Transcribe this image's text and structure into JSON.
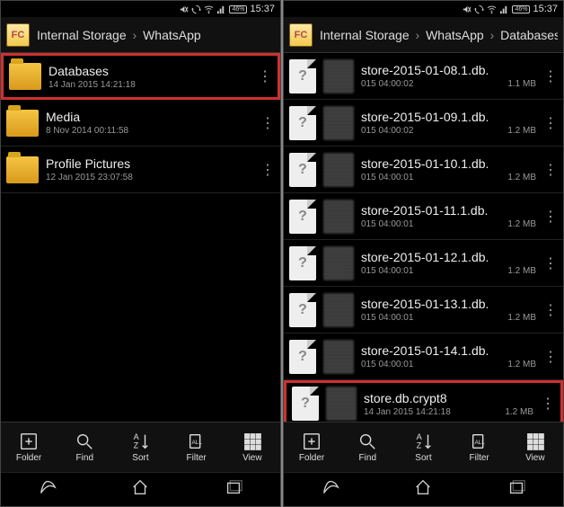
{
  "left": {
    "status": {
      "battery": "46%",
      "time": "15:37"
    },
    "breadcrumb": [
      "Internal Storage",
      "WhatsApp"
    ],
    "rows": [
      {
        "name": "Databases",
        "date": "14 Jan 2015 14:21:18",
        "size": "",
        "highlight": true
      },
      {
        "name": "Media",
        "date": "8 Nov 2014 00:11:58",
        "size": "",
        "highlight": false
      },
      {
        "name": "Profile Pictures",
        "date": "12 Jan 2015 23:07:58",
        "size": "",
        "highlight": false
      }
    ]
  },
  "right": {
    "status": {
      "battery": "46%",
      "time": "15:37"
    },
    "breadcrumb": [
      "Internal Storage",
      "WhatsApp",
      "Databases"
    ],
    "rows": [
      {
        "name": "store-2015-01-08.1.db.",
        "date": "015 04:00:02",
        "size": "1.1 MB",
        "highlight": false
      },
      {
        "name": "store-2015-01-09.1.db.",
        "date": "015 04:00:02",
        "size": "1.2 MB",
        "highlight": false
      },
      {
        "name": "store-2015-01-10.1.db.",
        "date": "015 04:00:01",
        "size": "1.2 MB",
        "highlight": false
      },
      {
        "name": "store-2015-01-11.1.db.",
        "date": "015 04:00:01",
        "size": "1.2 MB",
        "highlight": false
      },
      {
        "name": "store-2015-01-12.1.db.",
        "date": "015 04:00:01",
        "size": "1.2 MB",
        "highlight": false
      },
      {
        "name": "store-2015-01-13.1.db.",
        "date": "015 04:00:01",
        "size": "1.2 MB",
        "highlight": false
      },
      {
        "name": "store-2015-01-14.1.db.",
        "date": "015 04:00:01",
        "size": "1.2 MB",
        "highlight": false
      },
      {
        "name": "store.db.crypt8",
        "date": "14 Jan 2015 14:21:18",
        "size": "1.2 MB",
        "highlight": true
      }
    ]
  },
  "toolbar": {
    "folder": "Folder",
    "find": "Find",
    "sort": "Sort",
    "filter": "Filter",
    "view": "View"
  },
  "app_icon_text": "FC"
}
